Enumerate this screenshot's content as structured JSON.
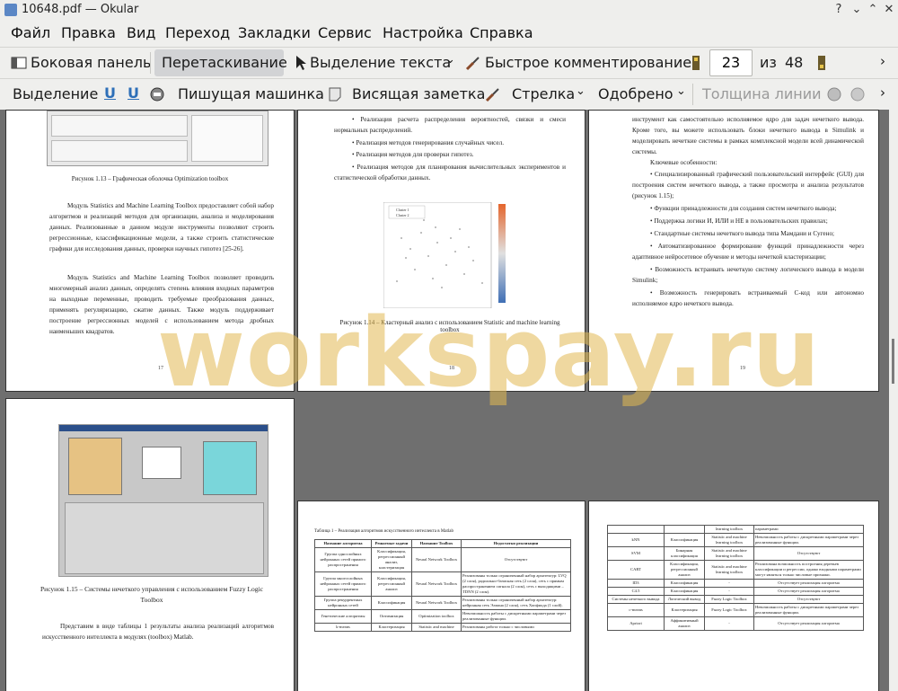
{
  "window": {
    "title": "10648.pdf — Okular",
    "buttons": {
      "help": "?",
      "minimize": "⌄",
      "maximize": "⌃",
      "close": "✕"
    }
  },
  "menu": [
    "Файл",
    "Правка",
    "Вид",
    "Переход",
    "Закладки",
    "Сервис",
    "Настройка",
    "Справка"
  ],
  "toolbar1": {
    "sidebar": "Боковая панель",
    "drag": "Перетаскивание",
    "text_select": "Выделение текста",
    "quick_annot": "Быстрое комментирование",
    "page_current": "23",
    "page_of": "из",
    "page_total": "48"
  },
  "toolbar2": {
    "select": "Выделение",
    "typewriter": "Пишущая машинка",
    "note": "Висящая заметка",
    "arrow": "Стрелка",
    "stamp": "Одобрено",
    "line_width": "Толщина линии"
  },
  "watermark": "workspay.ru",
  "pages": {
    "p17": {
      "figure_caption": "Рисунок 1.13 – Графическая оболочка Optimization toolbox",
      "para1": "Модуль Statistics and Machine Learning Toolbox предоставляет собой набор алгоритмов и реализаций методов для организации, анализа и моделирования данных. Реализованные в данном модуле инструменты позволяют строить регрессионные, классификационные модели, а также строить статистические графики для исследования данных, проверки научных гипотез [25-26].",
      "para2": "Модуль Statistics and Machine Learning Toolbox позволяет проводить многомерный анализ данных, определять степень влияния входных параметров на выходные переменные, проводить требуемые преобразования данных, применять регуляризацию, сжатие данных. Также модуль поддерживает построение регрессионных моделей с использованием метода дробных наименьших квадратов.",
      "number": "17"
    },
    "p18": {
      "b1": "• Реализация расчета распределения вероятностей, связки и смеси нормальных распределений.",
      "b2": "• Реализация методов генерирования случайных чисел.",
      "b3": "• Реализация методов для проверки гипотез.",
      "b4": "• Реализация методов для планирования вычислительных экспериментов и статистической обработки данных.",
      "legend1": "Cluster 1",
      "legend2": "Cluster 2",
      "figure_caption": "Рисунок 1.14 – Кластерный анализ с использованием Statistic and machine learning toolbox",
      "number": "18"
    },
    "p19": {
      "para1": "инструмент как самостоятельно исполняемое ядро для задач нечеткого вывода. Кроме того, вы можете использовать блоки нечеткого вывода в Simulink и моделировать нечеткие системы в рамках комплексной модели всей динамической системы.",
      "features": "Ключевые особенности:",
      "f1": "• Специализированный графический пользовательский интерфейс (GUI) для построения систем нечеткого вывода, а также просмотра и анализа результатов (рисунок 1.15);",
      "f2": "• Функции принадлежности для создания систем нечеткого вывода;",
      "f3": "• Поддержка логики И, ИЛИ и НЕ в пользовательских правилах;",
      "f4": "• Стандартные системы нечеткого вывода типа Мамдани и Сугено;",
      "f5": "• Автоматизированное формирование функций принадлежности через адаптивное нейросетевое обучение и методы нечеткой кластеризации;",
      "f6": "• Возможность встраивать нечеткую систему логического вывода в модели Simulink;",
      "f7": "• Возможность генерировать встраиваемый C-код или автономно исполняемое ядро нечеткого вывода.",
      "number": "19"
    },
    "p20": {
      "figure_caption": "Рисунок 1.15 – Системы нечеткого управления с использованием Fuzzy Logic Toolbox",
      "para1": "Представим в виде таблицы 1 результаты анализа реализаций алгоритмов искусственного интеллекта в модулях (toolbox) Matlab."
    },
    "p21": {
      "table_title": "Таблица 1 – Реализация алгоритмов искусственного интеллекта в Matlab",
      "headers": [
        "Название алгоритма",
        "Решаемые задачи",
        "Название Toolbox",
        "Недостатки реализации"
      ],
      "rows": [
        [
          "Группа однослойных нейронных сетей прямого распространения",
          "Классификация, регрессионный анализ, кластеризация",
          "Neural Network Toolbox",
          "Отсутствуют"
        ],
        [
          "Группа многослойных нейронных сетей прямого распространения",
          "Классификация, регрессионный анализ",
          "Neural Network Toolbox",
          "Реализованы только ограниченный набор архитектур: LVQ (2 слоя), радиально-базисная сеть (2 слоя), сеть с прямым распространением сигнала (2 слоя), сеть с выходящими – TDNN (2 слоя)."
        ],
        [
          "Группа рекуррентных нейронных сетей",
          "Классификация",
          "Neural Network Toolbox",
          "Реализованы только ограниченный набор архитектур: нейронная сеть Элмана (2 слоя), сеть Хопфилда (1 слой)."
        ],
        [
          "Генетические алгоритмы",
          "Оптимизация",
          "Optimization toolbox",
          "Невозможность работы с дискретными параметрами через реализованные функции."
        ],
        [
          "k-means",
          "Кластеризация",
          "Statistic and machine",
          "Реализованы работа только с числовыми"
        ]
      ]
    },
    "p22": {
      "rows": [
        [
          "",
          "",
          "learning toolbox",
          "параметрами"
        ],
        [
          "kNN",
          "Классификация",
          "Statistic and machine learning toolbox",
          "Невозможность работы с дискретными параметрами через реализованные функции."
        ],
        [
          "SVM",
          "Бинарная классификация",
          "Statistic and machine learning toolbox",
          "Отсутствуют"
        ],
        [
          "CART",
          "Классификация, регрессионный анализ",
          "Statistic and machine learning toolbox",
          "Реализована возможность построения деревьев классификации и регрессии, однако входными параметрами могут являться только числовые признаки."
        ],
        [
          "ID3",
          "Классификация",
          "-",
          "Отсутствует реализация алгоритма"
        ],
        [
          "C4.5",
          "Классификация",
          "-",
          "Отсутствует реализация алгоритма"
        ],
        [
          "Системы нечеткого вывода",
          "Логический вывод",
          "Fuzzy Logic Toolbox",
          "Отсутствуют"
        ],
        [
          "c-means",
          "Кластеризация",
          "Fuzzy Logic Toolbox",
          "Невозможность работы с дискретными параметрами через реализованные функции."
        ],
        [
          "Apriori",
          "Аффинитивный анализ",
          "-",
          "Отсутствует реализация алгоритма"
        ]
      ]
    }
  },
  "colors": {
    "watermark": "#e3ba53",
    "active_button": "#d2d3d5",
    "toolbar": "#efefed"
  }
}
